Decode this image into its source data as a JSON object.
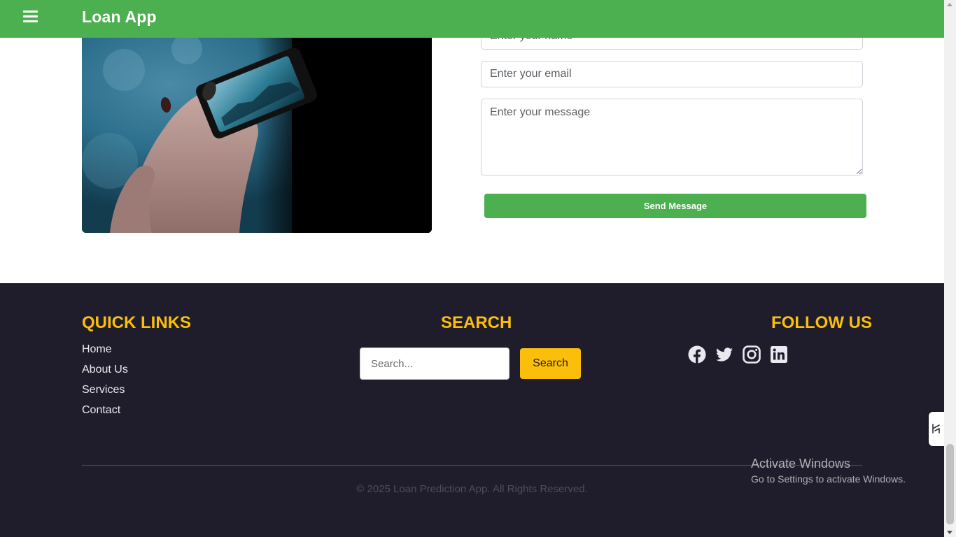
{
  "navbar": {
    "brand": "Loan App",
    "background": "#4caf50",
    "menu_icon": "hamburger-menu-icon"
  },
  "contact": {
    "image_alt": "hand-holding-phone-photo",
    "name_placeholder": "Enter your name",
    "email_placeholder": "Enter your email",
    "message_placeholder": "Enter your message",
    "send_label": "Send Message",
    "button_color": "#4caf50"
  },
  "footer": {
    "background": "#1f1d2b",
    "accent": "#fbbf0b",
    "quick_links": {
      "title": "QUICK LINKS",
      "items": [
        {
          "label": "Home"
        },
        {
          "label": "About Us"
        },
        {
          "label": "Services"
        },
        {
          "label": "Contact"
        }
      ]
    },
    "search": {
      "title": "SEARCH",
      "placeholder": "Search...",
      "button_label": "Search"
    },
    "follow": {
      "title": "FOLLOW US",
      "icons": [
        "facebook-icon",
        "twitter-icon",
        "instagram-icon",
        "linkedin-icon"
      ]
    },
    "copyright": "© 2025 Loan Prediction App. All Rights Reserved."
  },
  "windows_watermark": {
    "title": "Activate Windows",
    "subtitle": "Go to Settings to activate Windows."
  }
}
